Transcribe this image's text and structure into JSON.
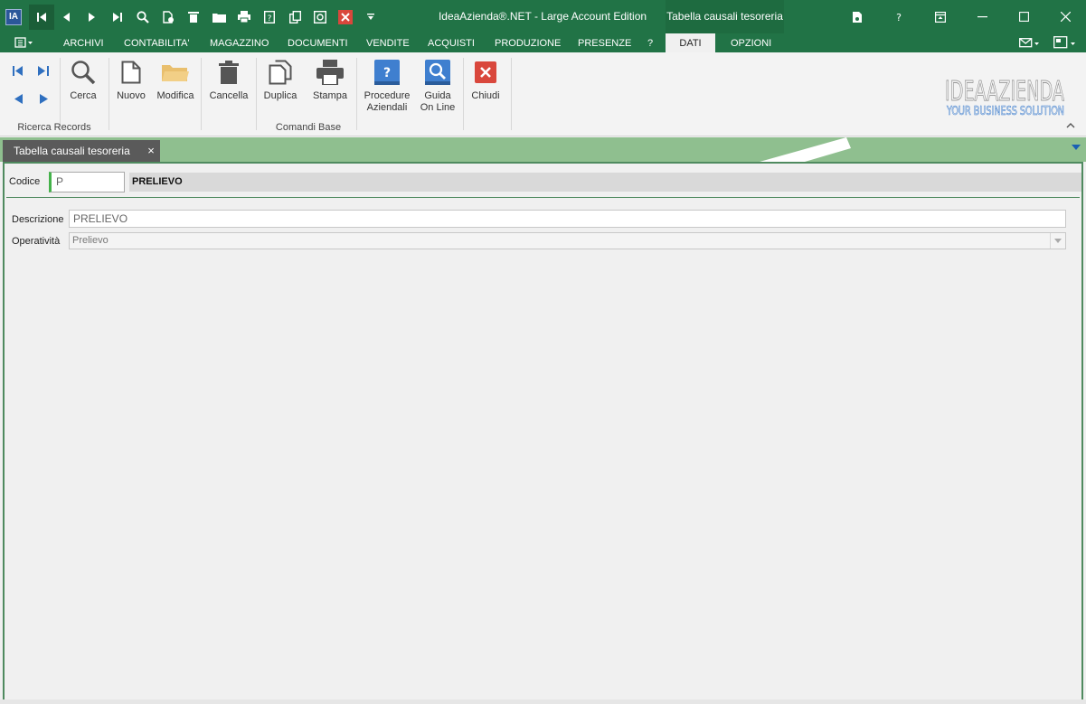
{
  "app": {
    "title": "IdeaAzienda®.NET - Large Account Edition",
    "context_tab_title": "Tabella causali tesoreria"
  },
  "menu": {
    "items": [
      "ARCHIVI",
      "CONTABILITA'",
      "MAGAZZINO",
      "DOCUMENTI",
      "VENDITE",
      "ACQUISTI",
      "PRODUZIONE",
      "PRESENZE",
      "?",
      "DATI",
      "OPZIONI"
    ],
    "active": "DATI"
  },
  "ribbon": {
    "buttons": {
      "cerca": "Cerca",
      "nuovo": "Nuovo",
      "modifica": "Modifica",
      "cancella": "Cancella",
      "duplica": "Duplica",
      "stampa": "Stampa",
      "procedure_line1": "Procedure",
      "procedure_line2": "Aziendali",
      "guida_line1": "Guida",
      "guida_line2": "On Line",
      "chiudi": "Chiudi"
    },
    "groups": {
      "ricerca": "Ricerca Records",
      "comandi": "Comandi Base"
    },
    "logo_line1": "IDEAAZIENDA",
    "logo_line2": "YOUR BUSINESS SOLUTION"
  },
  "document_tab": {
    "label": "Tabella causali tesoreria",
    "close_glyph": "×"
  },
  "form": {
    "codice_label": "Codice",
    "codice_value": "P",
    "record_name": "PRELIEVO",
    "descrizione_label": "Descrizione",
    "descrizione_value": "PRELIEVO",
    "operativita_label": "Operatività",
    "operativita_value": "Prelievo"
  },
  "colors": {
    "title_bar": "#217346",
    "context_tab": "#1e6b40",
    "tab_strip": "#8fbf8f",
    "form_border": "#4f8a5f",
    "codice_accent": "#44b24a"
  }
}
